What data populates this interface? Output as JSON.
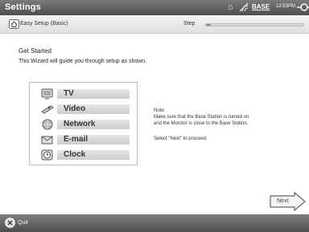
{
  "titlebar": {
    "title": "Settings",
    "base_label": "BASE",
    "clock": "12:53PM"
  },
  "header": {
    "breadcrumb": "Easy Setup (Basic)",
    "step_label": "Step",
    "step_progress": 0.05
  },
  "main": {
    "heading": "Get Started",
    "intro": "This Wizard will guide you through setup as shown.",
    "menu": [
      {
        "label": "TV",
        "icon": "tv-icon"
      },
      {
        "label": "Video",
        "icon": "video-icon"
      },
      {
        "label": "Network",
        "icon": "network-icon"
      },
      {
        "label": "E-mail",
        "icon": "email-icon"
      },
      {
        "label": "Clock",
        "icon": "clock-icon"
      }
    ],
    "note_title": "Note:",
    "note_line1": "Make sure that the Base Station is turned on",
    "note_line2": "and the Monitor is close to the Base Station.",
    "proceed": "Select \"Next\" to proceed."
  },
  "actions": {
    "next_label": "Next"
  },
  "footer": {
    "quit_label": "Quit"
  }
}
